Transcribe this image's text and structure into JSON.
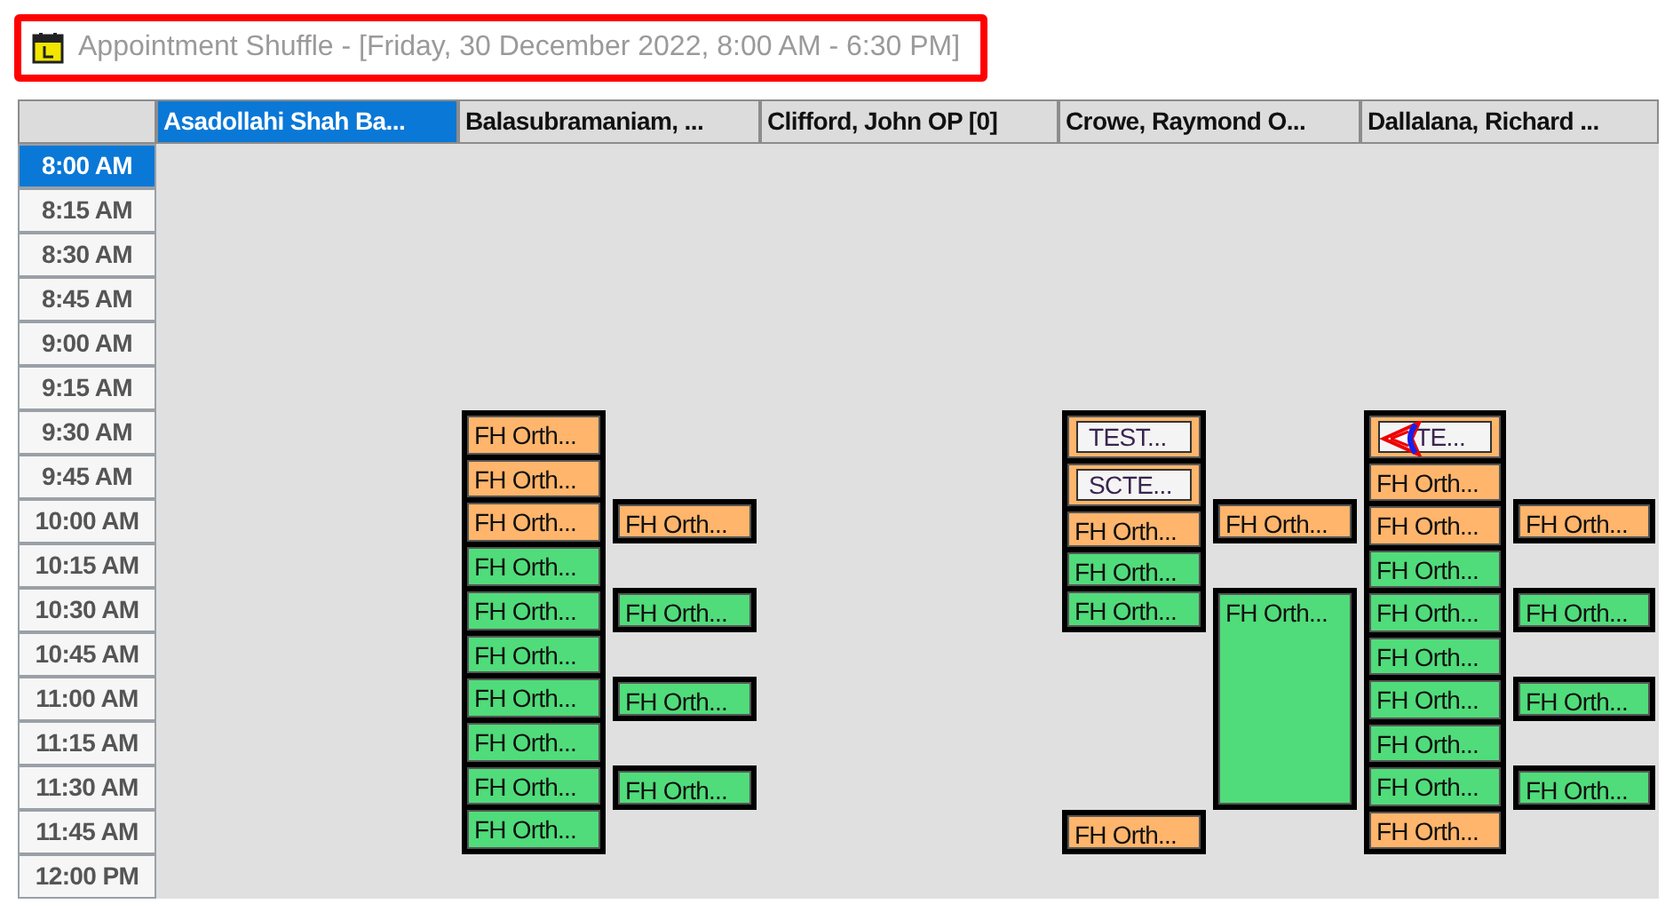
{
  "window": {
    "title": "Appointment Shuffle - [Friday, 30 December 2022, 8:00 AM - 6:30 PM]"
  },
  "resources": [
    {
      "name": "Asadollahi Shah Ba...",
      "selected": true
    },
    {
      "name": "Balasubramaniam, ...",
      "selected": false,
      "lanes": [
        [
          {
            "kind": "gap"
          },
          {
            "kind": "gap"
          },
          {
            "kind": "gap"
          },
          {
            "kind": "gap"
          },
          {
            "kind": "gap"
          },
          {
            "kind": "gap"
          },
          {
            "kind": "group",
            "blocks": [
              {
                "kind": "appointment",
                "label": "FH Orth...",
                "color": "#ffb56b"
              },
              {
                "kind": "appointment",
                "label": "FH Orth...",
                "color": "#ffb56b"
              },
              {
                "kind": "appointment",
                "label": "FH Orth...",
                "color": "#ffb56b"
              },
              {
                "kind": "appointment",
                "label": "FH Orth...",
                "color": "#50dc7a"
              },
              {
                "kind": "appointment",
                "label": "FH Orth...",
                "color": "#50dc7a"
              },
              {
                "kind": "appointment",
                "label": "FH Orth...",
                "color": "#50dc7a"
              },
              {
                "kind": "appointment",
                "label": "FH Orth...",
                "color": "#50dc7a"
              },
              {
                "kind": "appointment",
                "label": "FH Orth...",
                "color": "#50dc7a"
              },
              {
                "kind": "appointment",
                "label": "FH Orth...",
                "color": "#50dc7a"
              },
              {
                "kind": "appointment",
                "label": "FH Orth...",
                "color": "#50dc7a"
              }
            ]
          }
        ],
        [
          {
            "kind": "gap"
          },
          {
            "kind": "gap"
          },
          {
            "kind": "gap"
          },
          {
            "kind": "gap"
          },
          {
            "kind": "gap"
          },
          {
            "kind": "gap"
          },
          {
            "kind": "gap"
          },
          {
            "kind": "gap"
          },
          {
            "kind": "group",
            "blocks": [
              {
                "kind": "appointment",
                "label": "FH Orth...",
                "color": "#ffb56b"
              }
            ]
          },
          {
            "kind": "gap"
          },
          {
            "kind": "group",
            "blocks": [
              {
                "kind": "appointment",
                "label": "FH Orth...",
                "color": "#50dc7a"
              }
            ]
          },
          {
            "kind": "gap"
          },
          {
            "kind": "group",
            "blocks": [
              {
                "kind": "appointment",
                "label": "FH Orth...",
                "color": "#50dc7a"
              }
            ]
          },
          {
            "kind": "gap"
          },
          {
            "kind": "group",
            "blocks": [
              {
                "kind": "appointment",
                "label": "FH Orth...",
                "color": "#50dc7a"
              }
            ]
          }
        ]
      ]
    },
    {
      "name": "Clifford, John OP [0]",
      "selected": false
    },
    {
      "name": "Crowe, Raymond O...",
      "selected": false,
      "lanes": [
        [
          {
            "kind": "gap"
          },
          {
            "kind": "gap"
          },
          {
            "kind": "gap"
          },
          {
            "kind": "gap"
          },
          {
            "kind": "gap"
          },
          {
            "kind": "gap"
          },
          {
            "kind": "group",
            "blocks": [
              {
                "kind": "note",
                "label": "TEST...",
                "color": "#ffb56b",
                "flagged": false
              },
              {
                "kind": "note",
                "label": "SCTE...",
                "color": "#ffb56b",
                "flagged": false
              },
              {
                "kind": "appointment",
                "label": "FH Orth...",
                "color": "#ffb56b"
              },
              {
                "kind": "appointment",
                "label": "FH Orth...",
                "color": "#50dc7a"
              },
              {
                "kind": "appointment",
                "label": "FH Orth...",
                "color": "#50dc7a"
              }
            ]
          },
          {
            "kind": "gap"
          },
          {
            "kind": "gap"
          },
          {
            "kind": "gap"
          },
          {
            "kind": "gap"
          },
          {
            "kind": "group",
            "blocks": [
              {
                "kind": "appointment",
                "label": "FH Orth...",
                "color": "#ffb56b"
              }
            ]
          }
        ],
        [
          {
            "kind": "gap"
          },
          {
            "kind": "gap"
          },
          {
            "kind": "gap"
          },
          {
            "kind": "gap"
          },
          {
            "kind": "gap"
          },
          {
            "kind": "gap"
          },
          {
            "kind": "gap"
          },
          {
            "kind": "gap"
          },
          {
            "kind": "group",
            "blocks": [
              {
                "kind": "appointment",
                "label": "FH Orth...",
                "color": "#ffb56b"
              }
            ]
          },
          {
            "kind": "gap"
          },
          {
            "kind": "group",
            "blocks": [
              {
                "kind": "appointment",
                "label": "FH Orth...",
                "color": "#50dc7a"
              },
              {
                "kind": "continuation"
              },
              {
                "kind": "continuation"
              },
              {
                "kind": "continuation"
              },
              {
                "kind": "continuation"
              }
            ]
          }
        ]
      ]
    },
    {
      "name": "Dallalana, Richard ...",
      "selected": false,
      "lanes": [
        [
          {
            "kind": "gap"
          },
          {
            "kind": "gap"
          },
          {
            "kind": "gap"
          },
          {
            "kind": "gap"
          },
          {
            "kind": "gap"
          },
          {
            "kind": "gap"
          },
          {
            "kind": "group",
            "blocks": [
              {
                "kind": "note",
                "label": "TE...",
                "color": "#ffb56b",
                "flagged": true
              },
              {
                "kind": "appointment",
                "label": "FH Orth...",
                "color": "#ffb56b"
              },
              {
                "kind": "appointment",
                "label": "FH Orth...",
                "color": "#ffb56b"
              },
              {
                "kind": "appointment",
                "label": "FH Orth...",
                "color": "#50dc7a"
              },
              {
                "kind": "appointment",
                "label": "FH Orth...",
                "color": "#50dc7a"
              },
              {
                "kind": "appointment",
                "label": "FH Orth...",
                "color": "#50dc7a"
              },
              {
                "kind": "appointment",
                "label": "FH Orth...",
                "color": "#50dc7a"
              },
              {
                "kind": "appointment",
                "label": "FH Orth...",
                "color": "#50dc7a"
              },
              {
                "kind": "appointment",
                "label": "FH Orth...",
                "color": "#50dc7a"
              },
              {
                "kind": "appointment",
                "label": "FH Orth...",
                "color": "#ffb56b"
              }
            ]
          }
        ],
        [
          {
            "kind": "gap"
          },
          {
            "kind": "gap"
          },
          {
            "kind": "gap"
          },
          {
            "kind": "gap"
          },
          {
            "kind": "gap"
          },
          {
            "kind": "gap"
          },
          {
            "kind": "gap"
          },
          {
            "kind": "gap"
          },
          {
            "kind": "group",
            "blocks": [
              {
                "kind": "appointment",
                "label": "FH Orth...",
                "color": "#ffb56b"
              }
            ]
          },
          {
            "kind": "gap"
          },
          {
            "kind": "group",
            "blocks": [
              {
                "kind": "appointment",
                "label": "FH Orth...",
                "color": "#50dc7a"
              }
            ]
          },
          {
            "kind": "gap"
          },
          {
            "kind": "group",
            "blocks": [
              {
                "kind": "appointment",
                "label": "FH Orth...",
                "color": "#50dc7a"
              }
            ]
          },
          {
            "kind": "gap"
          },
          {
            "kind": "group",
            "blocks": [
              {
                "kind": "appointment",
                "label": "FH Orth...",
                "color": "#50dc7a"
              }
            ]
          }
        ]
      ]
    }
  ],
  "times": [
    {
      "label": "8:00 AM",
      "selected": true
    },
    {
      "label": "8:15 AM",
      "selected": false
    },
    {
      "label": "8:30 AM",
      "selected": false
    },
    {
      "label": "8:45 AM",
      "selected": false
    },
    {
      "label": "9:00 AM",
      "selected": false
    },
    {
      "label": "9:15 AM",
      "selected": false
    },
    {
      "label": "9:30 AM",
      "selected": false
    },
    {
      "label": "9:45 AM",
      "selected": false
    },
    {
      "label": "10:00 AM",
      "selected": false
    },
    {
      "label": "10:15 AM",
      "selected": false
    },
    {
      "label": "10:30 AM",
      "selected": false
    },
    {
      "label": "10:45 AM",
      "selected": false
    },
    {
      "label": "11:00 AM",
      "selected": false
    },
    {
      "label": "11:15 AM",
      "selected": false
    },
    {
      "label": "11:30 AM",
      "selected": false
    },
    {
      "label": "11:45 AM",
      "selected": false
    },
    {
      "label": "12:00 PM",
      "selected": false
    }
  ]
}
